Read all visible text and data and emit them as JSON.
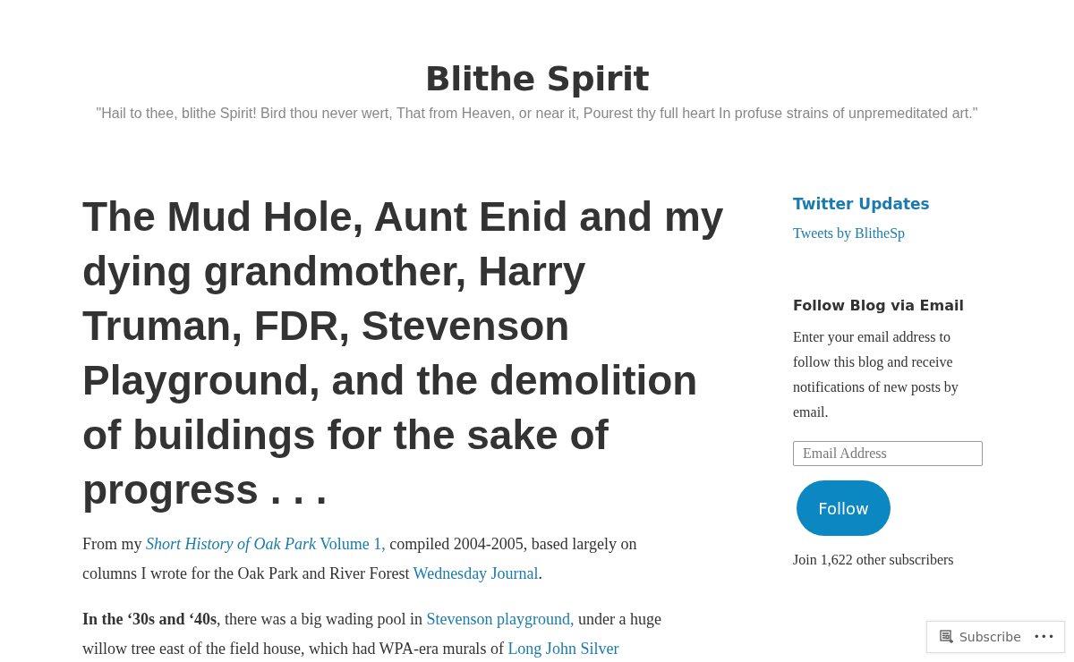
{
  "site": {
    "title": "Blithe Spirit",
    "tagline": "\"Hail to thee, blithe Spirit! Bird thou never wert, That from Heaven, or near it, Pourest thy full heart In profuse strains of unpremeditated art.\""
  },
  "post": {
    "title": "The Mud Hole, Aunt Enid and my dying grandmother, Harry Truman, FDR, Stevenson Playground, and the demolition of buildings for the sake of progress . . .",
    "paragraphs": [
      [
        {
          "kind": "text",
          "text": "From my "
        },
        {
          "kind": "link",
          "text": "*Short History of Oak Park* Volume 1,"
        },
        {
          "kind": "text",
          "text": " compiled 2004-2005, based largely on columns I wrote for the Oak Park and River Forest "
        },
        {
          "kind": "link",
          "text": "Wednesday Journal"
        },
        {
          "kind": "text",
          "text": "."
        }
      ],
      [
        {
          "kind": "text",
          "text": "**In the ‘30s and ‘40s**, there was a big wading pool in "
        },
        {
          "kind": "link",
          "text": "Stevenson playground,"
        },
        {
          "kind": "text",
          "text": " under a huge willow tree east of the field house, which had WPA-era murals of "
        },
        {
          "kind": "link",
          "text": "Long John Silver"
        }
      ]
    ]
  },
  "sidebar": {
    "twitter": {
      "heading": "Twitter Updates",
      "link": "Tweets by BlitheSp"
    },
    "follow": {
      "heading": "Follow Blog via Email",
      "text": "Enter your email address to follow this blog and receive notifications of new posts by email.",
      "placeholder": "Email Address",
      "button": "Follow",
      "subscribers": "Join 1,622 other subscribers"
    }
  },
  "subscribe_bar": {
    "label": "Subscribe",
    "more": "•••"
  }
}
